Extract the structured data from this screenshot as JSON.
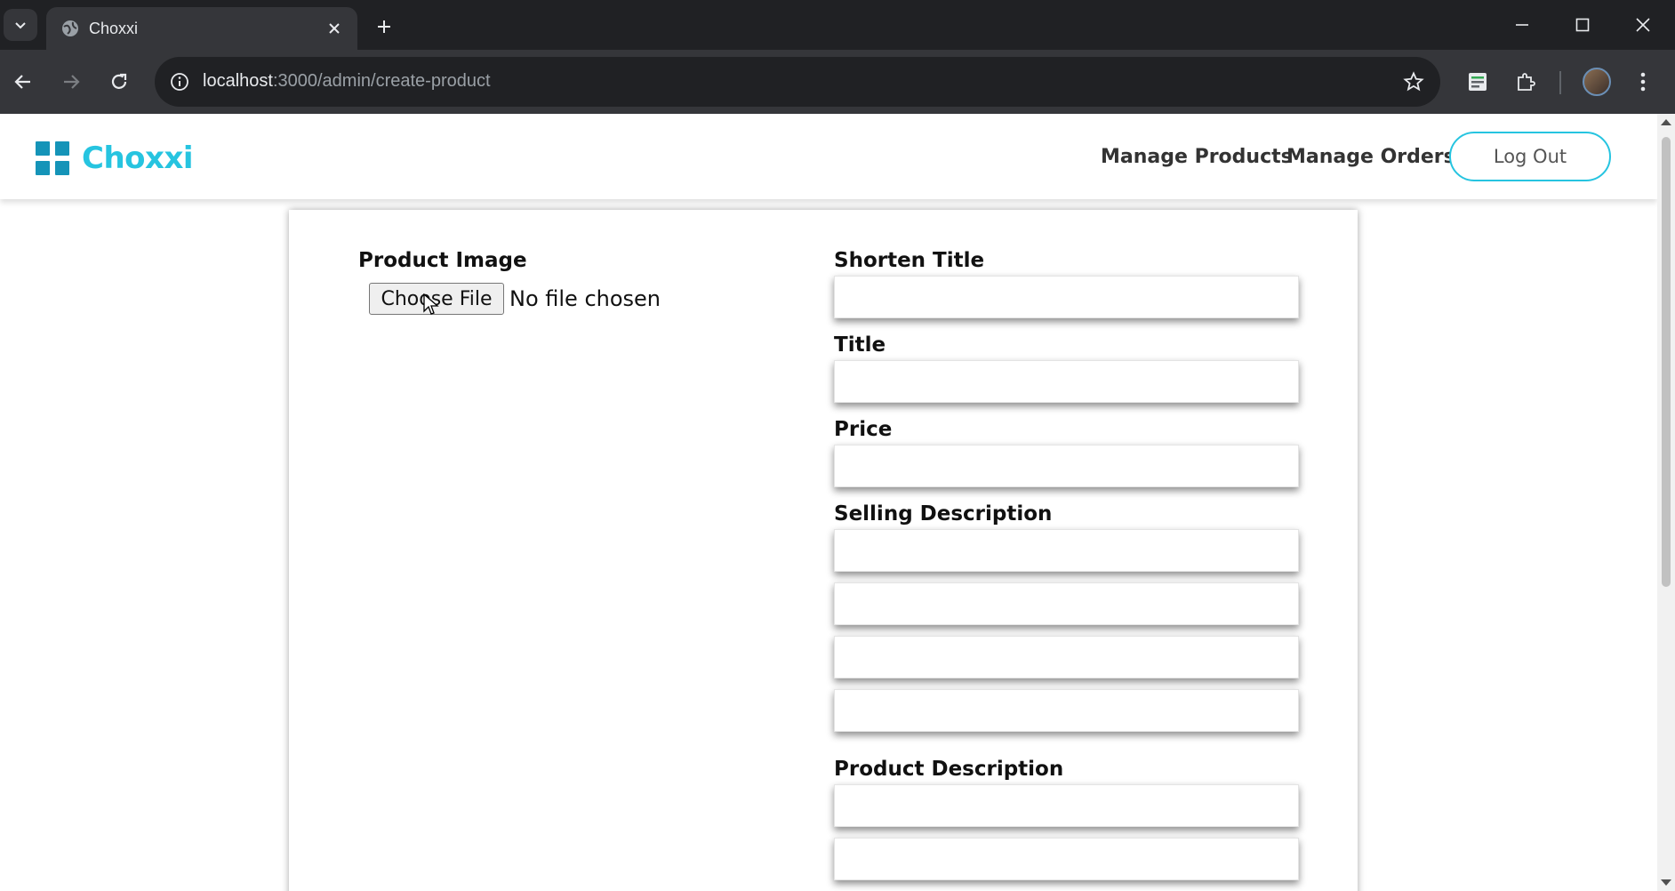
{
  "browser": {
    "tab_title": "Choxxi",
    "url_host": "localhost",
    "url_path": ":3000/admin/create-product"
  },
  "site": {
    "logo_text": "Choxxi",
    "nav": {
      "manage_products": "Manage Products",
      "manage_orders": "Manage Orders",
      "logout": "Log Out"
    }
  },
  "form": {
    "product_image_label": "Product Image",
    "choose_file_label": "Choose File",
    "file_status": "No file chosen",
    "shorten_title_label": "Shorten Title",
    "title_label": "Title",
    "price_label": "Price",
    "selling_description_label": "Selling Description",
    "product_description_label": "Product Description"
  },
  "colors": {
    "brand": "#26c4e0",
    "logo_icon": "#1594b8"
  }
}
